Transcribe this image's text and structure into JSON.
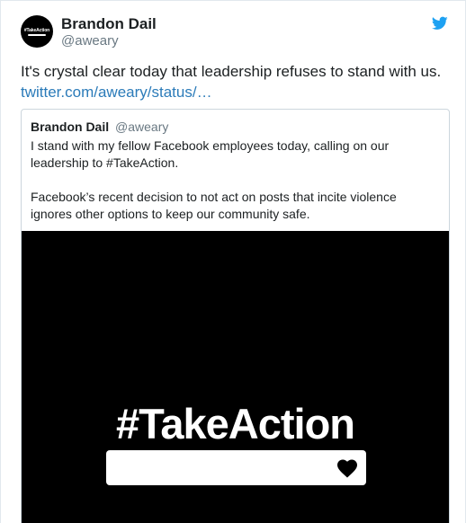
{
  "tweet": {
    "author_name": "Brandon Dail",
    "author_handle": "@aweary",
    "text": "It's crystal clear today that leadership refuses to stand with us.",
    "link": "twitter.com/aweary/status/…",
    "avatar_text": "#TakeAction"
  },
  "quoted": {
    "author_name": "Brandon Dail",
    "author_handle": "@aweary",
    "paragraphs": [
      "I stand with my fellow Facebook employees today, calling on our leadership to #TakeAction.",
      "Facebook’s recent decision to not act on posts that incite violence ignores other options to keep our community safe."
    ],
    "media_title": "#TakeAction"
  },
  "icons": {
    "brand": "twitter-bird-icon",
    "media": "heart-icon"
  },
  "colors": {
    "link": "#2b7bb9",
    "twitter_blue": "#1da1f2",
    "muted": "#697882",
    "media_bg": "#000000"
  }
}
